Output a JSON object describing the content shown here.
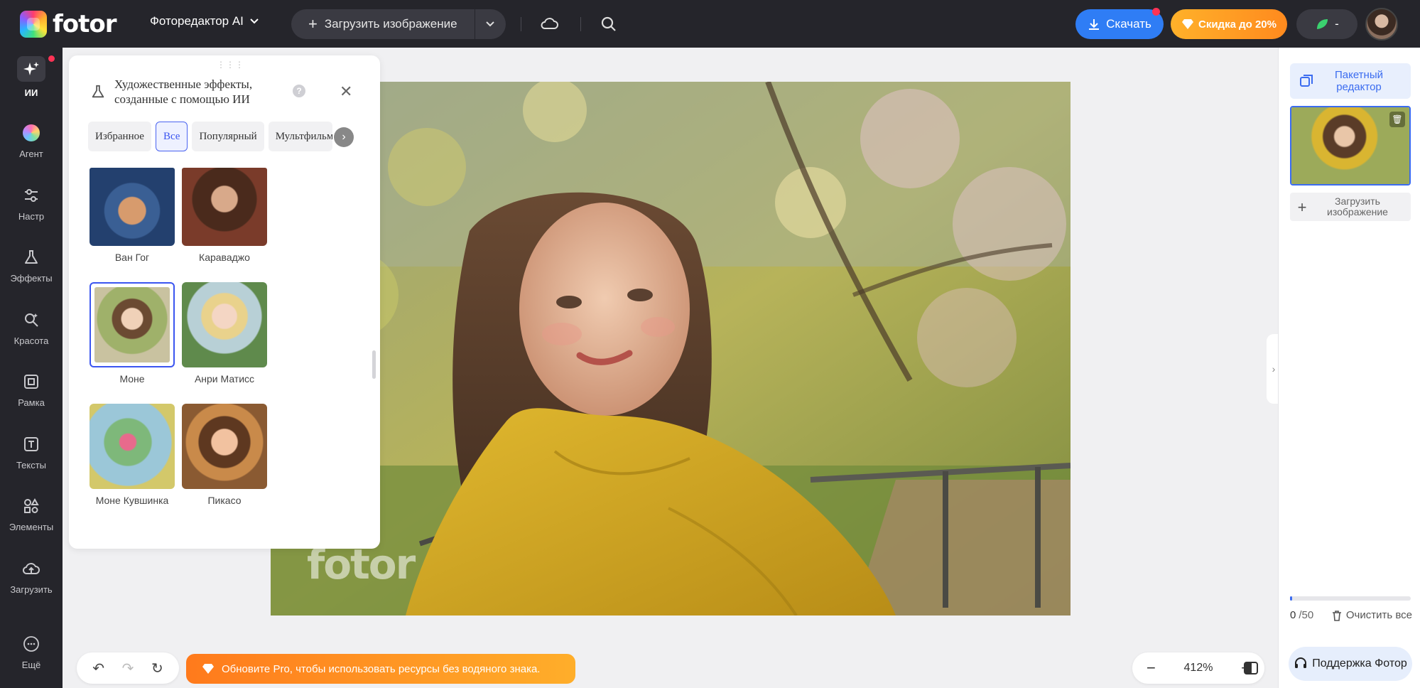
{
  "app": {
    "logo_text": "fotor",
    "editor_menu": "Фоторедактор AI",
    "upload_label": "Загрузить изображение",
    "download_label": "Скачать",
    "discount_label": "Скидка до 20%",
    "credits_label": "-",
    "colors": {
      "topbar": "#25252b",
      "accent": "#2f7df5",
      "discount": "#ffa028"
    }
  },
  "sidebar": {
    "items": [
      {
        "label": "ИИ",
        "icon": "sparkles-icon",
        "active": true
      },
      {
        "label": "Агент",
        "icon": "color-orb-icon"
      },
      {
        "label": "Настр",
        "icon": "sliders-icon"
      },
      {
        "label": "Эффекты",
        "icon": "flask-icon"
      },
      {
        "label": "Красота",
        "icon": "magic-wand-icon"
      },
      {
        "label": "Рамка",
        "icon": "frame-icon"
      },
      {
        "label": "Тексты",
        "icon": "text-icon"
      },
      {
        "label": "Элементы",
        "icon": "shapes-icon"
      },
      {
        "label": "Загрузить",
        "icon": "cloud-upload-icon"
      },
      {
        "label": "Ещё",
        "icon": "more-icon"
      }
    ]
  },
  "panel": {
    "title": "Художественные эффекты, созданные с помощью ИИ",
    "tabs": [
      "Избранное",
      "Все",
      "Популярный",
      "Мультфильм"
    ],
    "active_tab": "Все",
    "effects": [
      {
        "label": "Ван Гог"
      },
      {
        "label": "Караваджо"
      },
      {
        "label": "Моне",
        "selected": true
      },
      {
        "label": "Анри Матисс"
      },
      {
        "label": "Моне Кувшинка"
      },
      {
        "label": "Пикасо"
      }
    ]
  },
  "canvas": {
    "watermark": "fotor",
    "zoom": "412%"
  },
  "right_panel": {
    "batch_label": "Пакетный редактор",
    "add_image_label": "Загрузить изображение",
    "count_current": "0",
    "count_total": "/50",
    "upload_progress": 0.02,
    "clear_label": "Очистить все",
    "support_label": "Поддержка Фотор"
  },
  "bottom": {
    "pro_banner": "Обновите Pro, чтобы использовать ресурсы без водяного знака."
  }
}
